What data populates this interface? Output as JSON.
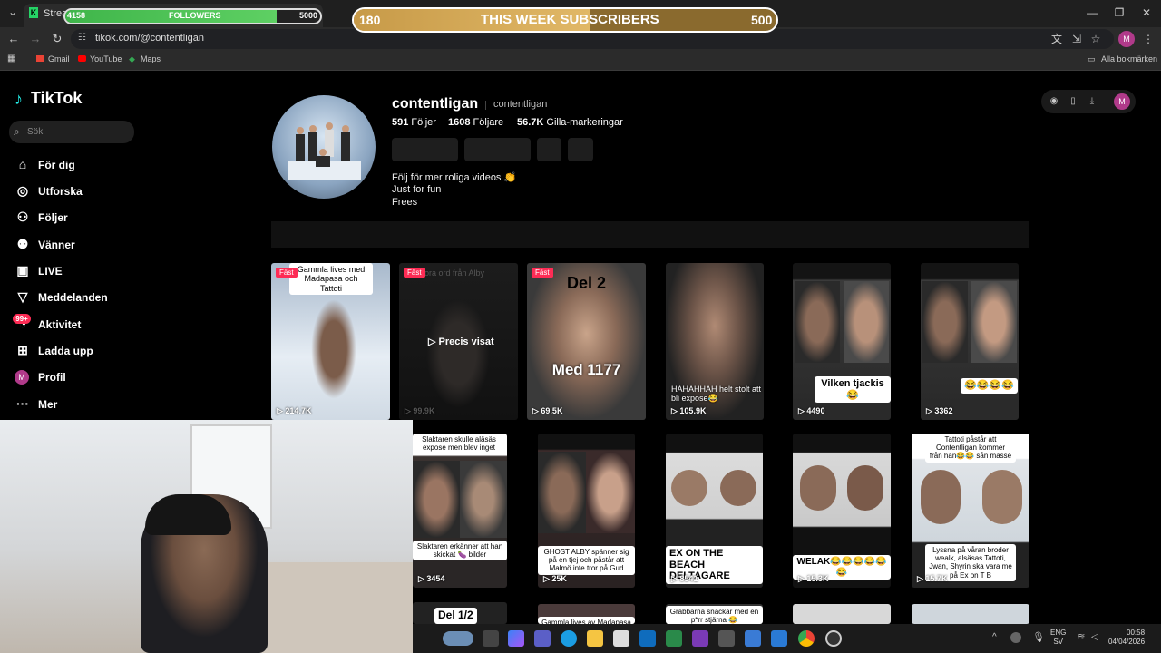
{
  "browser": {
    "tab_title": "Stream",
    "url": "tikok.com/@contentligan",
    "bookmarks": [
      "Gmail",
      "YouTube",
      "Maps"
    ],
    "bookmarks_right": "Alla bokmärken"
  },
  "overlays": {
    "followers": {
      "min": "4158",
      "label": "FOLLOWERS",
      "max": "5000",
      "fraction": 0.83
    },
    "subscribers": {
      "min": "180",
      "label": "THIS WEEK SUBSCRIBERS",
      "max": "500",
      "fraction": 0.56
    }
  },
  "sidebar": {
    "logo": "TikTok",
    "search_placeholder": "Sök",
    "items": [
      {
        "label": "För dig",
        "icon": "home-icon"
      },
      {
        "label": "Utforska",
        "icon": "compass-icon"
      },
      {
        "label": "Följer",
        "icon": "following-icon"
      },
      {
        "label": "Vänner",
        "icon": "friends-icon"
      },
      {
        "label": "LIVE",
        "icon": "live-icon"
      },
      {
        "label": "Meddelanden",
        "icon": "messages-icon"
      },
      {
        "label": "Aktivitet",
        "icon": "activity-icon"
      },
      {
        "label": "Ladda upp",
        "icon": "upload-icon"
      },
      {
        "label": "Profil",
        "icon": "profile-icon"
      },
      {
        "label": "Mer",
        "icon": "more-icon"
      }
    ],
    "activity_badge": "99+",
    "profile_initial": "M"
  },
  "profile": {
    "username": "contentligan",
    "nickname": "contentligan",
    "following_count": "591",
    "following_label": "Följer",
    "followers_count": "1608",
    "followers_label": "Följare",
    "likes_count": "56.7K",
    "likes_label": "Gilla-markeringar",
    "bio": [
      "Följ för mer roliga videos 👏",
      "Just for fun",
      "Frees"
    ],
    "top_initial": "M"
  },
  "videos": {
    "pinned_label": "Fäst",
    "row1": [
      {
        "views": "214.7K",
        "caption": "Gammla lives med Madapasa och Tattoti",
        "pinned": true
      },
      {
        "views": "99.9K",
        "caption": "ora ord från Alby",
        "pinned": true,
        "hover": "▷ Precis visat"
      },
      {
        "views": "69.5K",
        "big_top": "Del 2",
        "big_bottom": "Med 1177",
        "pinned": true
      },
      {
        "views": "105.9K",
        "caption": "HAHAHHAH helt stolt att bli expose😂"
      },
      {
        "views": "4490",
        "caption": "Vilken tjackis😂"
      },
      {
        "views": "3362",
        "caption": "😂😂😂😂"
      }
    ],
    "row2": [
      {
        "views": "3454",
        "caption_top": "Slaktaren skulle aläsäs expose men blev inget",
        "caption": "Slaktaren erkänner att han skickat 🍆 bilder"
      },
      {
        "views": "25K",
        "caption": "GHOST ALBY spänner sig på en tjej och påstår att Malmö inte tror på Gud"
      },
      {
        "views": "8541",
        "caption": "EX ON THE BEACH DELTAGARE"
      },
      {
        "views": "15.3K",
        "caption": "WELAK😂😂😂😂😂😂"
      },
      {
        "views": "15.7K",
        "caption_top": "Tattoti påstår att Contentligan kommer från han😂😂 sån masse",
        "caption": "Lyssna på våran broder wealk, alsäsas Tattoti, Jwan, Shyrin ska vara me på Ex on T B"
      }
    ],
    "row3": [
      {
        "caption": "Del 1/2"
      },
      {
        "caption": "Gammla lives av Madapasa"
      },
      {
        "caption": "Grabbarna snackar med en p*rr stjärna 😂"
      }
    ]
  },
  "taskbar": {
    "lang": "ENG",
    "lang2": "SV",
    "time": "00:58",
    "date": "04/04/2026"
  }
}
